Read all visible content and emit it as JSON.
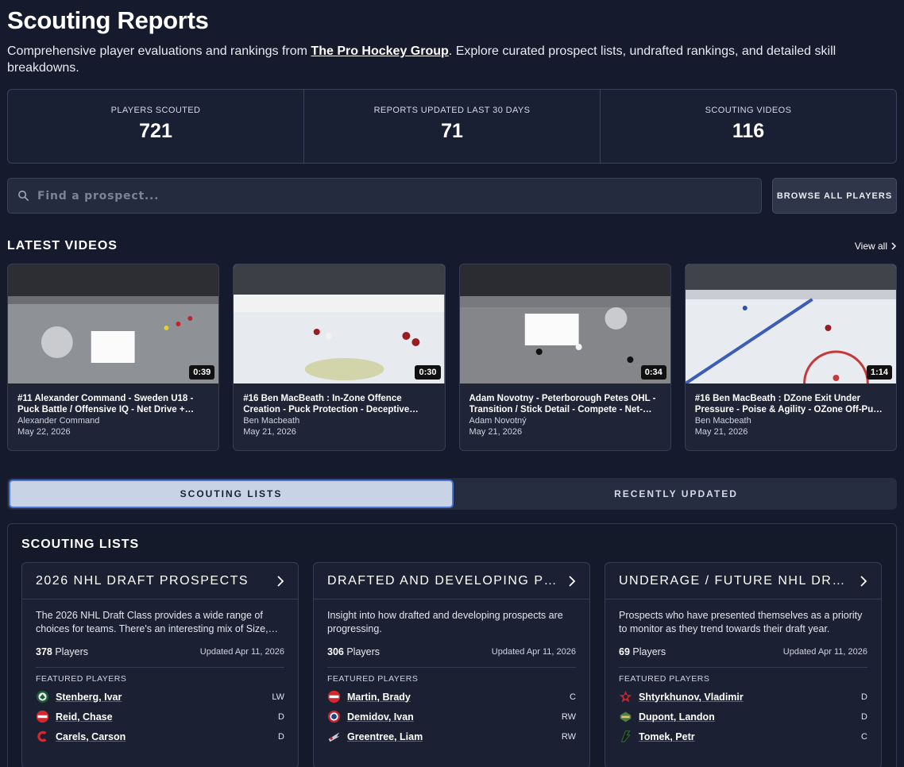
{
  "header": {
    "title": "Scouting Reports",
    "intro_before": "Comprehensive player evaluations and rankings from ",
    "brand": "The Pro Hockey Group",
    "intro_after": ". Explore curated prospect lists, undrafted rankings, and detailed skill breakdowns."
  },
  "stats": [
    {
      "label": "PLAYERS SCOUTED",
      "value": "721"
    },
    {
      "label": "REPORTS UPDATED LAST 30 DAYS",
      "value": "71"
    },
    {
      "label": "SCOUTING VIDEOS",
      "value": "116"
    }
  ],
  "search": {
    "placeholder": "Find a prospect...",
    "browse_label": "BROWSE ALL PLAYERS"
  },
  "videos_section": {
    "title": "LATEST VIDEOS",
    "view_all": "View all"
  },
  "videos": [
    {
      "title": "#11 Alexander Command - Sweden U18 - Puck Battle / Offensive IQ - Net Drive + Finish",
      "author": "Alexander Command",
      "date": "May 22, 2026",
      "duration": "0:39"
    },
    {
      "title": "#16 Ben MacBeath : In-Zone Offence Creation - Puck Protection - Deceptive Playmaking",
      "author": "Ben Macbeath",
      "date": "May 21, 2026",
      "duration": "0:30"
    },
    {
      "title": "Adam Novotny - Peterborough Petes OHL - Transition / Stick Detail - Compete - Net-Front",
      "author": "Adam Novotný",
      "date": "May 21, 2026",
      "duration": "0:34"
    },
    {
      "title": "#16 Ben MacBeath : DZone Exit Under Pressure - Poise & Agility - OZone Off-Puck Play",
      "author": "Ben Macbeath",
      "date": "May 21, 2026",
      "duration": "1:14"
    }
  ],
  "tabs": [
    {
      "label": "SCOUTING LISTS"
    },
    {
      "label": "RECENTLY UPDATED"
    }
  ],
  "lists_section": {
    "title": "SCOUTING LISTS",
    "featured_label": "FEATURED PLAYERS",
    "players_word": "Players"
  },
  "lists": [
    {
      "name": "2026 NHL DRAFT PROSPECTS",
      "desc": "The 2026 NHL Draft Class provides a wide range of choices for teams. There's an interesting mix of Size, Skill and Speed.",
      "count": "378",
      "updated": "Updated Apr 11, 2026",
      "players": [
        {
          "name": "Stenberg, Ivar",
          "pos": "LW",
          "logo": "frolunda-logo-icon"
        },
        {
          "name": "Reid, Chase",
          "pos": "D",
          "logo": "greyhounds-logo-icon"
        },
        {
          "name": "Carels, Carson",
          "pos": "D",
          "logo": "winterhawks-logo-icon"
        }
      ]
    },
    {
      "name": "DRAFTED AND DEVELOPING PROSPECTS",
      "desc": "Insight into how drafted and developing prospects are progressing.",
      "count": "306",
      "updated": "Updated Apr 11, 2026",
      "players": [
        {
          "name": "Martin, Brady",
          "pos": "C",
          "logo": "greyhounds-logo-icon"
        },
        {
          "name": "Demidov, Ivan",
          "pos": "RW",
          "logo": "canadiens-logo-icon"
        },
        {
          "name": "Greentree, Liam",
          "pos": "RW",
          "logo": "spitfires-logo-icon"
        }
      ]
    },
    {
      "name": "UNDERAGE / FUTURE NHL DRAFT PROSPECTS",
      "desc": "Prospects who have presented themselves as a priority to monitor as they trend towards their draft year.",
      "count": "69",
      "updated": "Updated Apr 11, 2026",
      "players": [
        {
          "name": "Shtyrkhunov, Vladimir",
          "pos": "D",
          "logo": "star-logo-icon"
        },
        {
          "name": "Dupont, Landon",
          "pos": "D",
          "logo": "silvertips-logo-icon"
        },
        {
          "name": "Tomek, Petr",
          "pos": "C",
          "logo": "tri-city-logo-icon"
        }
      ]
    }
  ],
  "colors": {
    "background": "#151a2c",
    "card": "#1f2537",
    "tab_active": "#c8d3e6",
    "tab_border": "#4a78d4"
  }
}
